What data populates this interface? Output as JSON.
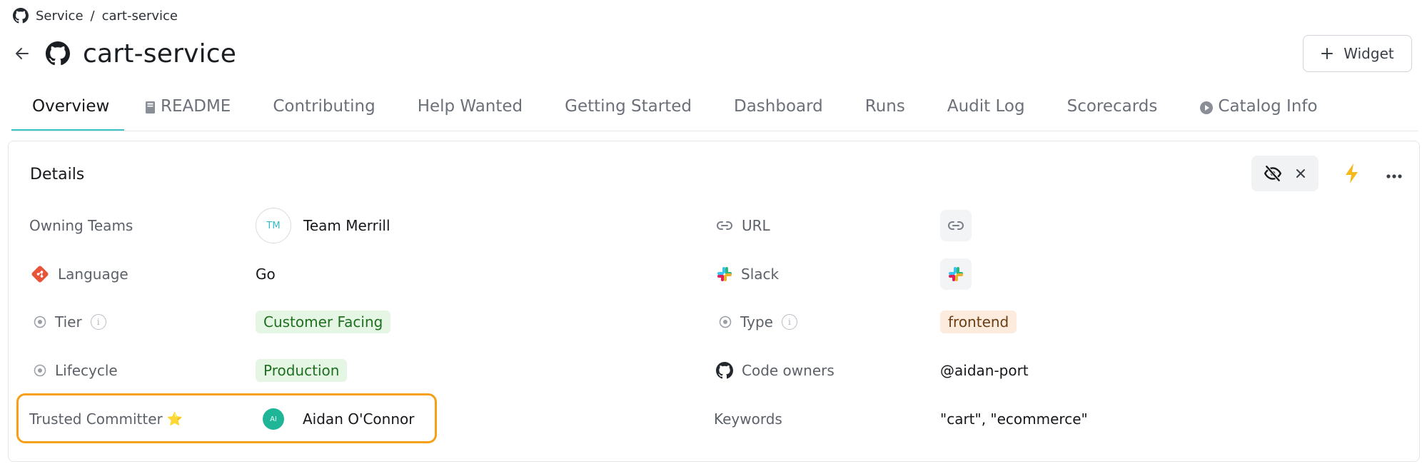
{
  "breadcrumb": {
    "root": "Service",
    "separator": "/",
    "current": "cart-service"
  },
  "page": {
    "title": "cart-service"
  },
  "widget_button": {
    "label": "Widget"
  },
  "tabs": [
    {
      "label": "Overview",
      "icon": ""
    },
    {
      "label": "README",
      "icon": "book-icon"
    },
    {
      "label": "Contributing",
      "icon": ""
    },
    {
      "label": "Help Wanted",
      "icon": ""
    },
    {
      "label": "Getting Started",
      "icon": ""
    },
    {
      "label": "Dashboard",
      "icon": ""
    },
    {
      "label": "Runs",
      "icon": ""
    },
    {
      "label": "Audit Log",
      "icon": ""
    },
    {
      "label": "Scorecards",
      "icon": ""
    },
    {
      "label": "Catalog Info",
      "icon": "play-circle-icon"
    }
  ],
  "active_tab": "Overview",
  "details": {
    "title": "Details",
    "left": {
      "owning_teams": {
        "label": "Owning Teams",
        "avatar_initials": "TM",
        "value": "Team Merrill"
      },
      "language": {
        "label": "Language",
        "value": "Go"
      },
      "tier": {
        "label": "Tier",
        "value": "Customer Facing"
      },
      "lifecycle": {
        "label": "Lifecycle",
        "value": "Production"
      },
      "trusted_committer": {
        "label": "Trusted Committer",
        "emoji": "⭐",
        "avatar_initials": "AI",
        "value": "Aidan O'Connor"
      }
    },
    "right": {
      "url": {
        "label": "URL"
      },
      "slack": {
        "label": "Slack"
      },
      "type": {
        "label": "Type",
        "value": "frontend"
      },
      "code_owners": {
        "label": "Code owners",
        "value": "@aidan-port"
      },
      "keywords": {
        "label": "Keywords",
        "value": "\"cart\", \"ecommerce\""
      }
    }
  },
  "colors": {
    "accent": "#3cc4c4",
    "highlight": "#f5a017",
    "tag_green_bg": "#e5f6e4",
    "tag_orange_bg": "#fdecde",
    "bolt": "#f5b91c"
  }
}
